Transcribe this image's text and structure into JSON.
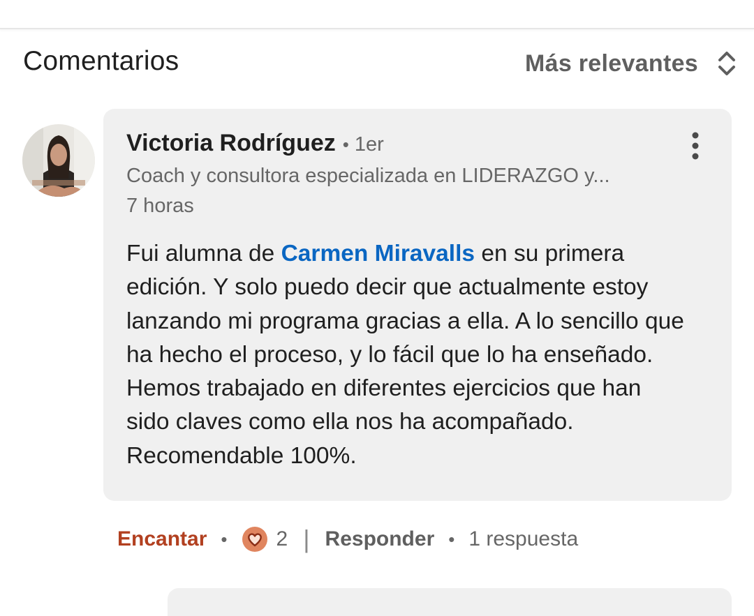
{
  "section": {
    "title": "Comentarios",
    "sort_label": "Más relevantes",
    "sort_icon": "chevron-up-down-icon"
  },
  "comment": {
    "author": {
      "name": "Victoria Rodríguez",
      "degree_separator": "•",
      "degree": "1er",
      "headline": "Coach y consultora especializada en LIDERAZGO y...",
      "avatar_icon": "profile-photo-woman"
    },
    "time": "7 horas",
    "more_icon": "vertical-ellipsis-icon",
    "text": {
      "before_mention": "Fui alumna de ",
      "mention": "Carmen Miravalls",
      "after_mention": " en su primera edición. Y solo puedo decir que actualmente estoy lanzando mi programa gracias a ella. A lo sencillo que ha hecho el proceso, y lo fácil que lo ha enseñado. Hemos trabajado en diferentes ejercicios que han sido claves como ella nos ha acompañado. Recomendable 100%."
    },
    "actions": {
      "reaction_label": "Encantar",
      "separator": "•",
      "reaction_icon": "love-reaction-icon",
      "reaction_count": "2",
      "divider": "|",
      "reply_label": "Responder",
      "replies": "1 respuesta"
    }
  },
  "colors": {
    "bubble_bg": "#f0f0f0",
    "mention": "#0a66c2",
    "love_action": "#b24020",
    "love_icon_fill": "#e0855f",
    "secondary_text": "#666666"
  }
}
